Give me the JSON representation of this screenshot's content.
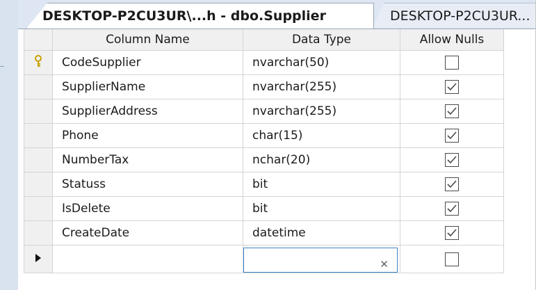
{
  "tabs": [
    {
      "label": "DESKTOP-P2CU3UR\\...h - dbo.Supplier",
      "active": true
    },
    {
      "label": "DESKTOP-P2CU3UR...",
      "active": false
    }
  ],
  "grid": {
    "headers": {
      "column_name": "Column Name",
      "data_type": "Data Type",
      "allow_nulls": "Allow Nulls"
    },
    "rows": [
      {
        "name": "CodeSupplier",
        "type": "nvarchar(50)",
        "allow_nulls": false,
        "primary_key": true
      },
      {
        "name": "SupplierName",
        "type": "nvarchar(255)",
        "allow_nulls": true
      },
      {
        "name": "SupplierAddress",
        "type": "nvarchar(255)",
        "allow_nulls": true
      },
      {
        "name": "Phone",
        "type": "char(15)",
        "allow_nulls": true
      },
      {
        "name": "NumberTax",
        "type": "nchar(20)",
        "allow_nulls": true
      },
      {
        "name": "Statuss",
        "type": "bit",
        "allow_nulls": true
      },
      {
        "name": "IsDelete",
        "type": "bit",
        "allow_nulls": true
      },
      {
        "name": "CreateDate",
        "type": "datetime",
        "allow_nulls": true
      }
    ],
    "new_row": {
      "name": "",
      "type": "",
      "allow_nulls": false
    }
  },
  "icons": {
    "primary_key": "key-icon",
    "row_pointer": "row-pointer-icon",
    "dropdown": "chevron-down-icon"
  },
  "colors": {
    "key": "#c9a100",
    "selection_border": "#3b82c7",
    "header_bg": "#f0f0f0"
  }
}
